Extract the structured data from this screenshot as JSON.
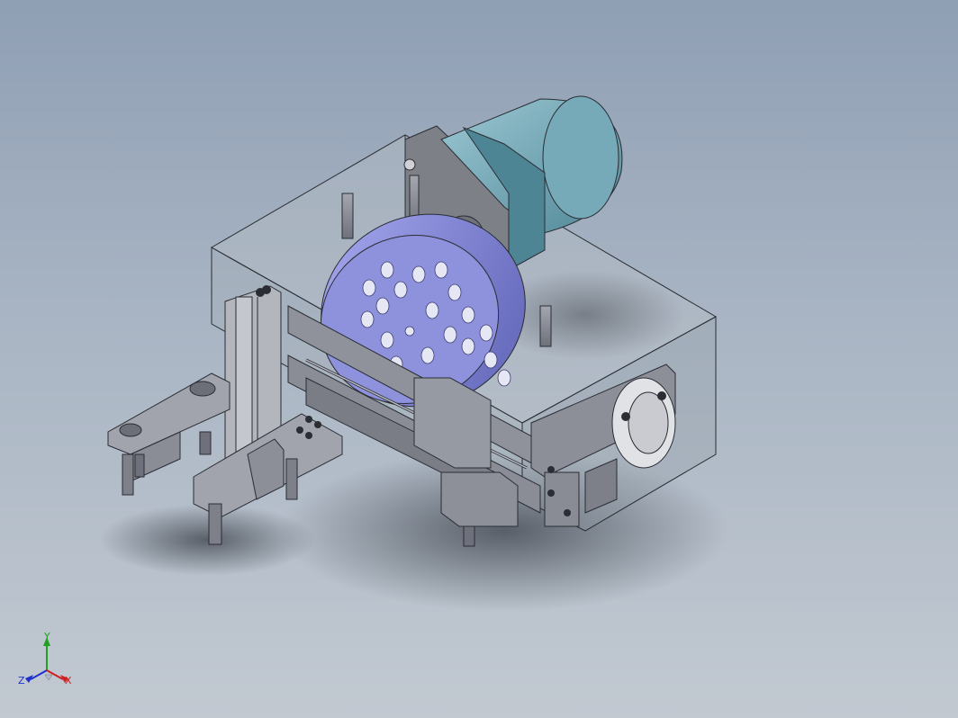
{
  "viewport": {
    "background_top": "#8f9fb4",
    "background_bottom": "#c2c9d1"
  },
  "model": {
    "motor_color": "#6fa3b3",
    "disc_color": "#8c8fd8",
    "frame_color": "#8a8d97",
    "enclosure_color": "#9aa6ad"
  },
  "triad": {
    "x_label": "X",
    "y_label": "Y",
    "z_label": "Z",
    "x_color": "#d02020",
    "y_color": "#20a020",
    "z_color": "#2030d0"
  }
}
